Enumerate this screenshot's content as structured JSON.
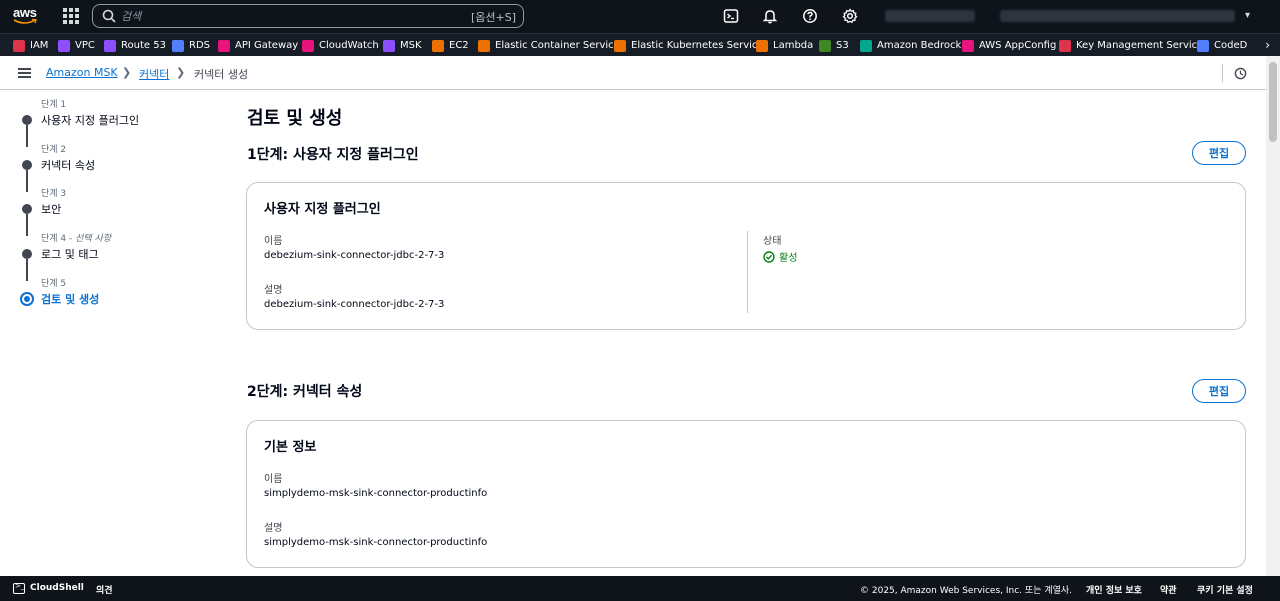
{
  "topnav": {
    "logo": "aws",
    "search_placeholder": "검색",
    "search_shortcut": "[옵션+S]",
    "icons": [
      "cloudshell-icon",
      "bell-icon",
      "help-icon",
      "gear-icon"
    ]
  },
  "favorites": [
    {
      "label": "IAM",
      "color": "#dd344c"
    },
    {
      "label": "VPC",
      "color": "#8c4fff"
    },
    {
      "label": "Route 53",
      "color": "#8c4fff"
    },
    {
      "label": "RDS",
      "color": "#527fff"
    },
    {
      "label": "API Gateway",
      "color": "#e7157b"
    },
    {
      "label": "CloudWatch",
      "color": "#e7157b"
    },
    {
      "label": "MSK",
      "color": "#8c4fff"
    },
    {
      "label": "EC2",
      "color": "#ed7100"
    },
    {
      "label": "Elastic Container Service",
      "color": "#ed7100"
    },
    {
      "label": "Elastic Kubernetes Service",
      "color": "#ed7100"
    },
    {
      "label": "Lambda",
      "color": "#ed7100"
    },
    {
      "label": "S3",
      "color": "#3f8624"
    },
    {
      "label": "Amazon Bedrock",
      "color": "#01a88d"
    },
    {
      "label": "AWS AppConfig",
      "color": "#e7157b"
    },
    {
      "label": "Key Management Service",
      "color": "#dd344c"
    },
    {
      "label": "CodeD",
      "color": "#527fff"
    }
  ],
  "breadcrumb": {
    "items": [
      "Amazon MSK",
      "커넥터",
      "커넥터 생성"
    ]
  },
  "steps": [
    {
      "num": "단계 1",
      "optional": "",
      "label": "사용자 지정 플러그인"
    },
    {
      "num": "단계 2",
      "optional": "",
      "label": "커넥터 속성"
    },
    {
      "num": "단계 3",
      "optional": "",
      "label": "보안"
    },
    {
      "num": "단계 4 - ",
      "optional": "선택 사항",
      "label": "로그 및 태그"
    },
    {
      "num": "단계 5",
      "optional": "",
      "label": "검토 및 생성"
    }
  ],
  "main": {
    "title": "검토 및 생성",
    "edit_label": "편집",
    "section1": {
      "title": "1단계: 사용자 지정 플러그인",
      "card_title": "사용자 지정 플러그인",
      "name_key": "이름",
      "name_val": "debezium-sink-connector-jdbc-2-7-3",
      "desc_key": "설명",
      "desc_val": "debezium-sink-connector-jdbc-2-7-3",
      "status_key": "상태",
      "status_val": "활성"
    },
    "section2": {
      "title": "2단계: 커넥터 속성",
      "card_title": "기본 정보",
      "name_key": "이름",
      "name_val": "simplydemo-msk-sink-connector-productinfo",
      "desc_key": "설명",
      "desc_val": "simplydemo-msk-sink-connector-productinfo"
    }
  },
  "footer": {
    "cloudshell": "CloudShell",
    "feedback": "의견",
    "copyright": "© 2025, Amazon Web Services, Inc. 또는 계열사.",
    "privacy": "개인 정보 보호",
    "terms": "약관",
    "cookies": "쿠키 기본 설정"
  }
}
